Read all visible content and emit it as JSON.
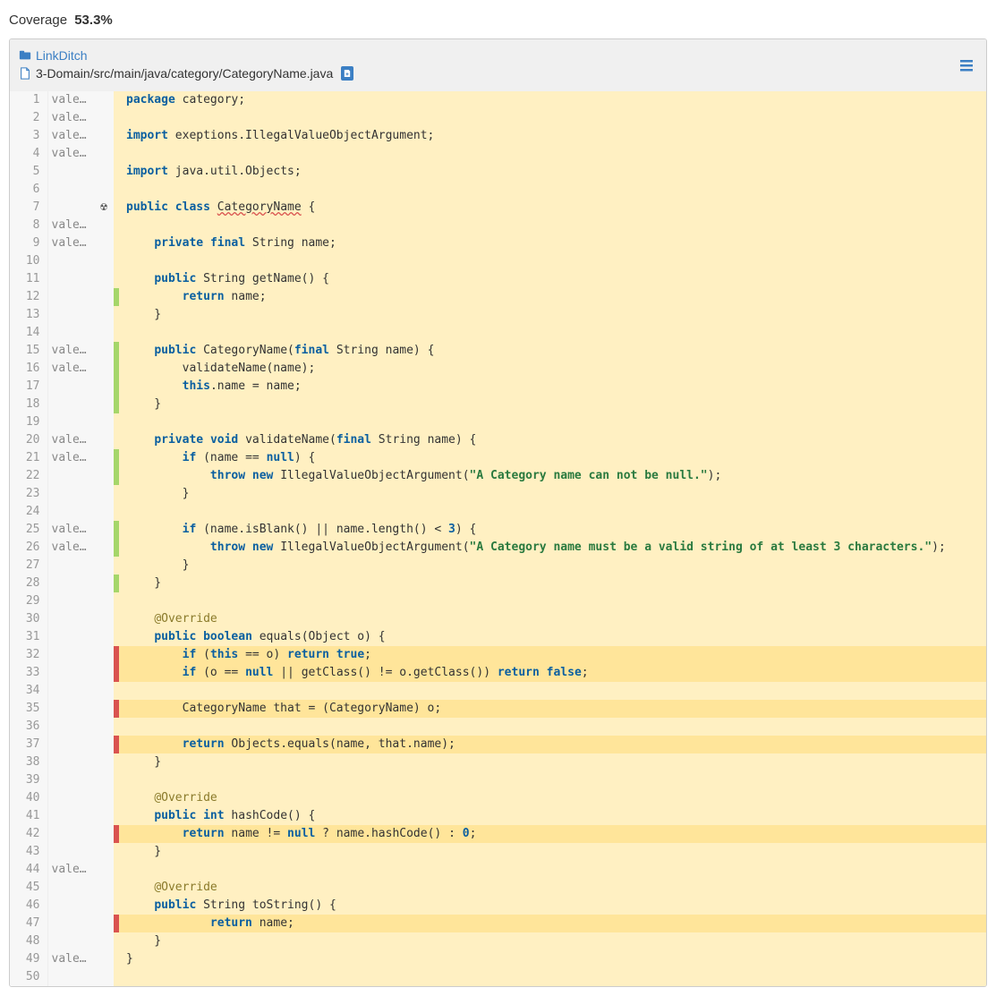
{
  "header": {
    "coverage_label": "Coverage",
    "coverage_value": "53.3%"
  },
  "breadcrumb": {
    "project": "LinkDitch",
    "file_path": "3-Domain/src/main/java/category/CategoryName.java"
  },
  "code": [
    {
      "n": 1,
      "author": "vale…",
      "gutter": "",
      "cov": "",
      "hl": false,
      "tokens": [
        {
          "t": "package",
          "c": "kw"
        },
        {
          "t": " category;"
        }
      ]
    },
    {
      "n": 2,
      "author": "vale…",
      "gutter": "",
      "cov": "",
      "hl": false,
      "tokens": []
    },
    {
      "n": 3,
      "author": "vale…",
      "gutter": "",
      "cov": "",
      "hl": false,
      "tokens": [
        {
          "t": "import",
          "c": "kw"
        },
        {
          "t": " exeptions.IllegalValueObjectArgument;"
        }
      ]
    },
    {
      "n": 4,
      "author": "vale…",
      "gutter": "",
      "cov": "",
      "hl": false,
      "tokens": []
    },
    {
      "n": 5,
      "author": "",
      "gutter": "",
      "cov": "",
      "hl": false,
      "tokens": [
        {
          "t": "import",
          "c": "kw"
        },
        {
          "t": " java.util.Objects;"
        }
      ]
    },
    {
      "n": 6,
      "author": "",
      "gutter": "",
      "cov": "",
      "hl": false,
      "tokens": []
    },
    {
      "n": 7,
      "author": "",
      "gutter": "rad",
      "cov": "",
      "hl": false,
      "tokens": [
        {
          "t": "public",
          "c": "kw"
        },
        {
          "t": " "
        },
        {
          "t": "class",
          "c": "kw"
        },
        {
          "t": " "
        },
        {
          "t": "CategoryName",
          "c": "err"
        },
        {
          "t": " {"
        }
      ]
    },
    {
      "n": 8,
      "author": "vale…",
      "gutter": "",
      "cov": "",
      "hl": false,
      "tokens": []
    },
    {
      "n": 9,
      "author": "vale…",
      "gutter": "",
      "cov": "",
      "hl": false,
      "tokens": [
        {
          "t": "    "
        },
        {
          "t": "private",
          "c": "kw"
        },
        {
          "t": " "
        },
        {
          "t": "final",
          "c": "kw"
        },
        {
          "t": " String name;"
        }
      ]
    },
    {
      "n": 10,
      "author": "",
      "gutter": "",
      "cov": "",
      "hl": false,
      "tokens": []
    },
    {
      "n": 11,
      "author": "",
      "gutter": "",
      "cov": "",
      "hl": false,
      "tokens": [
        {
          "t": "    "
        },
        {
          "t": "public",
          "c": "kw"
        },
        {
          "t": " String getName() {"
        }
      ]
    },
    {
      "n": 12,
      "author": "",
      "gutter": "",
      "cov": "green",
      "hl": false,
      "tokens": [
        {
          "t": "        "
        },
        {
          "t": "return",
          "c": "kw"
        },
        {
          "t": " name;"
        }
      ]
    },
    {
      "n": 13,
      "author": "",
      "gutter": "",
      "cov": "",
      "hl": false,
      "tokens": [
        {
          "t": "    }"
        }
      ]
    },
    {
      "n": 14,
      "author": "",
      "gutter": "",
      "cov": "",
      "hl": false,
      "tokens": []
    },
    {
      "n": 15,
      "author": "vale…",
      "gutter": "",
      "cov": "green",
      "hl": false,
      "tokens": [
        {
          "t": "    "
        },
        {
          "t": "public",
          "c": "kw"
        },
        {
          "t": " CategoryName("
        },
        {
          "t": "final",
          "c": "kw"
        },
        {
          "t": " String name) {"
        }
      ]
    },
    {
      "n": 16,
      "author": "vale…",
      "gutter": "",
      "cov": "green",
      "hl": false,
      "tokens": [
        {
          "t": "        validateName(name);"
        }
      ]
    },
    {
      "n": 17,
      "author": "",
      "gutter": "",
      "cov": "green",
      "hl": false,
      "tokens": [
        {
          "t": "        "
        },
        {
          "t": "this",
          "c": "kw"
        },
        {
          "t": ".name = name;"
        }
      ]
    },
    {
      "n": 18,
      "author": "",
      "gutter": "",
      "cov": "green",
      "hl": false,
      "tokens": [
        {
          "t": "    }"
        }
      ]
    },
    {
      "n": 19,
      "author": "",
      "gutter": "",
      "cov": "",
      "hl": false,
      "tokens": []
    },
    {
      "n": 20,
      "author": "vale…",
      "gutter": "",
      "cov": "",
      "hl": false,
      "tokens": [
        {
          "t": "    "
        },
        {
          "t": "private",
          "c": "kw"
        },
        {
          "t": " "
        },
        {
          "t": "void",
          "c": "kw"
        },
        {
          "t": " validateName("
        },
        {
          "t": "final",
          "c": "kw"
        },
        {
          "t": " String name) {"
        }
      ]
    },
    {
      "n": 21,
      "author": "vale…",
      "gutter": "",
      "cov": "green",
      "hl": false,
      "tokens": [
        {
          "t": "        "
        },
        {
          "t": "if",
          "c": "kw"
        },
        {
          "t": " (name == "
        },
        {
          "t": "null",
          "c": "kw"
        },
        {
          "t": ") {"
        }
      ]
    },
    {
      "n": 22,
      "author": "",
      "gutter": "",
      "cov": "green",
      "hl": false,
      "tokens": [
        {
          "t": "            "
        },
        {
          "t": "throw",
          "c": "kw"
        },
        {
          "t": " "
        },
        {
          "t": "new",
          "c": "kw"
        },
        {
          "t": " IllegalValueObjectArgument("
        },
        {
          "t": "\"A Category name can not be null.\"",
          "c": "str"
        },
        {
          "t": ");"
        }
      ]
    },
    {
      "n": 23,
      "author": "",
      "gutter": "",
      "cov": "",
      "hl": false,
      "tokens": [
        {
          "t": "        }"
        }
      ]
    },
    {
      "n": 24,
      "author": "",
      "gutter": "",
      "cov": "",
      "hl": false,
      "tokens": []
    },
    {
      "n": 25,
      "author": "vale…",
      "gutter": "",
      "cov": "green",
      "hl": false,
      "tokens": [
        {
          "t": "        "
        },
        {
          "t": "if",
          "c": "kw"
        },
        {
          "t": " (name.isBlank() || name.length() < "
        },
        {
          "t": "3",
          "c": "num"
        },
        {
          "t": ") {"
        }
      ]
    },
    {
      "n": 26,
      "author": "vale…",
      "gutter": "",
      "cov": "green",
      "hl": false,
      "tokens": [
        {
          "t": "            "
        },
        {
          "t": "throw",
          "c": "kw"
        },
        {
          "t": " "
        },
        {
          "t": "new",
          "c": "kw"
        },
        {
          "t": " IllegalValueObjectArgument("
        },
        {
          "t": "\"A Category name must be a valid string of at least 3 characters.\"",
          "c": "str"
        },
        {
          "t": ");"
        }
      ]
    },
    {
      "n": 27,
      "author": "",
      "gutter": "",
      "cov": "",
      "hl": false,
      "tokens": [
        {
          "t": "        }"
        }
      ]
    },
    {
      "n": 28,
      "author": "",
      "gutter": "",
      "cov": "green",
      "hl": false,
      "tokens": [
        {
          "t": "    }"
        }
      ]
    },
    {
      "n": 29,
      "author": "",
      "gutter": "",
      "cov": "",
      "hl": false,
      "tokens": []
    },
    {
      "n": 30,
      "author": "",
      "gutter": "",
      "cov": "",
      "hl": false,
      "tokens": [
        {
          "t": "    "
        },
        {
          "t": "@Override",
          "c": "ann"
        }
      ]
    },
    {
      "n": 31,
      "author": "",
      "gutter": "",
      "cov": "",
      "hl": false,
      "tokens": [
        {
          "t": "    "
        },
        {
          "t": "public",
          "c": "kw"
        },
        {
          "t": " "
        },
        {
          "t": "boolean",
          "c": "kw"
        },
        {
          "t": " equals(Object o) {"
        }
      ]
    },
    {
      "n": 32,
      "author": "",
      "gutter": "",
      "cov": "red",
      "hl": true,
      "tokens": [
        {
          "t": "        "
        },
        {
          "t": "if",
          "c": "kw"
        },
        {
          "t": " ("
        },
        {
          "t": "this",
          "c": "kw"
        },
        {
          "t": " == o) "
        },
        {
          "t": "return",
          "c": "kw"
        },
        {
          "t": " "
        },
        {
          "t": "true",
          "c": "kw"
        },
        {
          "t": ";"
        }
      ]
    },
    {
      "n": 33,
      "author": "",
      "gutter": "",
      "cov": "red",
      "hl": true,
      "tokens": [
        {
          "t": "        "
        },
        {
          "t": "if",
          "c": "kw"
        },
        {
          "t": " (o == "
        },
        {
          "t": "null",
          "c": "kw"
        },
        {
          "t": " || getClass() != o.getClass()) "
        },
        {
          "t": "return",
          "c": "kw"
        },
        {
          "t": " "
        },
        {
          "t": "false",
          "c": "kw"
        },
        {
          "t": ";"
        }
      ]
    },
    {
      "n": 34,
      "author": "",
      "gutter": "",
      "cov": "",
      "hl": false,
      "tokens": []
    },
    {
      "n": 35,
      "author": "",
      "gutter": "",
      "cov": "red",
      "hl": true,
      "tokens": [
        {
          "t": "        CategoryName that = (CategoryName) o;"
        }
      ]
    },
    {
      "n": 36,
      "author": "",
      "gutter": "",
      "cov": "",
      "hl": false,
      "tokens": []
    },
    {
      "n": 37,
      "author": "",
      "gutter": "",
      "cov": "red",
      "hl": true,
      "tokens": [
        {
          "t": "        "
        },
        {
          "t": "return",
          "c": "kw"
        },
        {
          "t": " Objects.equals(name, that.name);"
        }
      ]
    },
    {
      "n": 38,
      "author": "",
      "gutter": "",
      "cov": "",
      "hl": false,
      "tokens": [
        {
          "t": "    }"
        }
      ]
    },
    {
      "n": 39,
      "author": "",
      "gutter": "",
      "cov": "",
      "hl": false,
      "tokens": []
    },
    {
      "n": 40,
      "author": "",
      "gutter": "",
      "cov": "",
      "hl": false,
      "tokens": [
        {
          "t": "    "
        },
        {
          "t": "@Override",
          "c": "ann"
        }
      ]
    },
    {
      "n": 41,
      "author": "",
      "gutter": "",
      "cov": "",
      "hl": false,
      "tokens": [
        {
          "t": "    "
        },
        {
          "t": "public",
          "c": "kw"
        },
        {
          "t": " "
        },
        {
          "t": "int",
          "c": "kw"
        },
        {
          "t": " hashCode() {"
        }
      ]
    },
    {
      "n": 42,
      "author": "",
      "gutter": "",
      "cov": "red",
      "hl": true,
      "tokens": [
        {
          "t": "        "
        },
        {
          "t": "return",
          "c": "kw"
        },
        {
          "t": " name != "
        },
        {
          "t": "null",
          "c": "kw"
        },
        {
          "t": " ? name.hashCode() : "
        },
        {
          "t": "0",
          "c": "num"
        },
        {
          "t": ";"
        }
      ]
    },
    {
      "n": 43,
      "author": "",
      "gutter": "",
      "cov": "",
      "hl": false,
      "tokens": [
        {
          "t": "    }"
        }
      ]
    },
    {
      "n": 44,
      "author": "vale…",
      "gutter": "",
      "cov": "",
      "hl": false,
      "tokens": []
    },
    {
      "n": 45,
      "author": "",
      "gutter": "",
      "cov": "",
      "hl": false,
      "tokens": [
        {
          "t": "    "
        },
        {
          "t": "@Override",
          "c": "ann"
        }
      ]
    },
    {
      "n": 46,
      "author": "",
      "gutter": "",
      "cov": "",
      "hl": false,
      "tokens": [
        {
          "t": "    "
        },
        {
          "t": "public",
          "c": "kw"
        },
        {
          "t": " String toString() {"
        }
      ]
    },
    {
      "n": 47,
      "author": "",
      "gutter": "",
      "cov": "red",
      "hl": true,
      "tokens": [
        {
          "t": "            "
        },
        {
          "t": "return",
          "c": "kw"
        },
        {
          "t": " name;"
        }
      ]
    },
    {
      "n": 48,
      "author": "",
      "gutter": "",
      "cov": "",
      "hl": false,
      "tokens": [
        {
          "t": "    }"
        }
      ]
    },
    {
      "n": 49,
      "author": "vale…",
      "gutter": "",
      "cov": "",
      "hl": false,
      "tokens": [
        {
          "t": "}"
        }
      ]
    },
    {
      "n": 50,
      "author": "",
      "gutter": "",
      "cov": "",
      "hl": false,
      "tokens": []
    }
  ]
}
